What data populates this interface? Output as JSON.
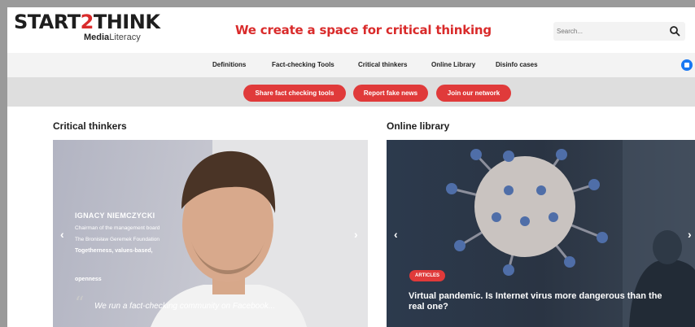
{
  "header": {
    "logo_main_a": "START",
    "logo_main_b": "2",
    "logo_main_c": "THINK",
    "logo_sub_bold": "Media",
    "logo_sub_rest": "Literacy",
    "tagline": "We create a space for critical thinking",
    "search_placeholder": "Search..."
  },
  "nav": {
    "items": [
      "Definitions",
      "Fact-checking Tools",
      "Critical thinkers",
      "Online Library",
      "Disinfo cases"
    ]
  },
  "cta": {
    "buttons": [
      "Share fact checking tools",
      "Report fake news",
      "Join our network"
    ]
  },
  "sections": {
    "left_title": "Critical thinkers",
    "right_title": "Online library"
  },
  "thinker": {
    "name": "IGNACY NIEMCZYCKI",
    "role": "Chairman of the management board",
    "org": "The Bronisław Geremek Foundation",
    "values": "Togetherness, values-based,",
    "values2": "openness",
    "quote": "We run a fact-checking community on Facebook..."
  },
  "article": {
    "badge": "ARTICLES",
    "title": "Virtual pandemic. Is Internet virus more dangerous than the real one?"
  },
  "colors": {
    "brand_red": "#d92b2b",
    "button_red": "#e03a3a",
    "facebook": "#1877f2"
  },
  "icons": {
    "search": "search-icon",
    "facebook": "facebook-icon",
    "prev": "chevron-left-icon",
    "next": "chevron-right-icon",
    "quote": "quote-icon"
  }
}
